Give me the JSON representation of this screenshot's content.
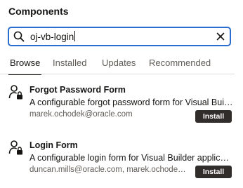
{
  "panel": {
    "title": "Components"
  },
  "search": {
    "value": "oj-vb-login",
    "search_icon": "search-icon",
    "clear_icon": "close-icon"
  },
  "tabs": [
    {
      "label": "Browse",
      "active": true
    },
    {
      "label": "Installed",
      "active": false
    },
    {
      "label": "Updates",
      "active": false
    },
    {
      "label": "Recommended",
      "active": false
    }
  ],
  "results": [
    {
      "name": "Forgot Password Form",
      "description": "A configurable forgot password form for Visual Builder applications",
      "authors": "marek.ochodek@oracle.com",
      "action": "Install",
      "icon": "user-lock-icon"
    },
    {
      "name": "Login Form",
      "description": "A configurable login form for Visual Builder applications",
      "authors": "duncan.mills@oracle.com, marek.ochodek@oracle.com",
      "action": "Install",
      "icon": "user-lock-icon"
    }
  ],
  "colors": {
    "accent": "#2a6ecf",
    "button": "#312d2a",
    "text": "#161513",
    "muted": "#615c57"
  }
}
